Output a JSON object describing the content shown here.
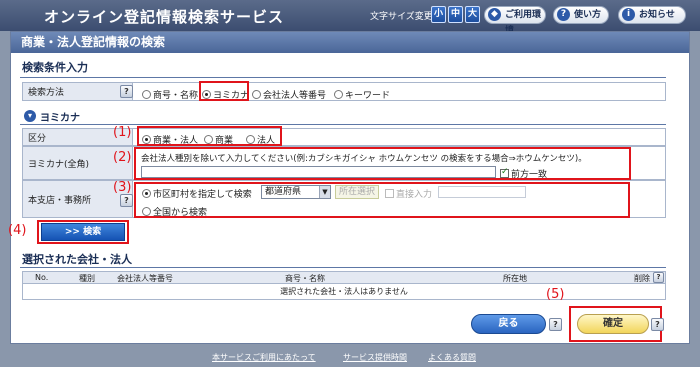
{
  "header": {
    "title": "オンライン登記情報検索サービス",
    "font_size_label": "文字サイズ変更",
    "font_sizes": [
      "小",
      "中",
      "大"
    ],
    "env_label": "ご利用環境",
    "usage_label": "使い方",
    "news_label": "お知らせ",
    "usage_icon": "?",
    "news_icon": "i",
    "env_icon": "◆"
  },
  "page_title": "商業・法人登記情報の検索",
  "search": {
    "section_title": "検索条件入力",
    "method_label": "検索方法",
    "methods": [
      "商号・名称",
      "ヨミカナ",
      "会社法人等番号",
      "キーワード"
    ],
    "method_selected": "ヨミカナ"
  },
  "yomi": {
    "section_title": "ヨミカナ",
    "kubun_label": "区分",
    "kubun_options": [
      "商業・法人",
      "商業",
      "法人"
    ],
    "kubun_selected": "商業・法人",
    "kana_label": "ヨミカナ(全角)",
    "kana_hint": "会社法人種別を除いて入力してください(例:カブシキガイシャ ホウムケンセツ の検索をする場合⇒ホウムケンセツ)。",
    "kana_value": "",
    "prefix_match_label": "前方一致",
    "prefix_match_checked": true,
    "office_label": "本支店・事務所",
    "office_option_city": "市区町村を指定して検索",
    "office_option_all": "全国から検索",
    "pref_select": "都道府県",
    "location_select_btn": "所在選択",
    "direct_input_label": "直接入力",
    "direct_input_value": ""
  },
  "search_button": ">> 検索",
  "annotations": [
    "(1)",
    "(2)",
    "(3)",
    "(4)",
    "(5)"
  ],
  "results": {
    "section_title": "選択された会社・法人",
    "columns": [
      "No.",
      "種別",
      "会社法人等番号",
      "商号・名称",
      "所在地",
      "削除"
    ],
    "empty_message": "選択された会社・法人はありません"
  },
  "buttons": {
    "back": "戻る",
    "confirm": "確定",
    "help": "?"
  },
  "footer": {
    "links": [
      "本サービスご利用にあたって",
      "サービス提供時間",
      "よくある質問"
    ]
  }
}
